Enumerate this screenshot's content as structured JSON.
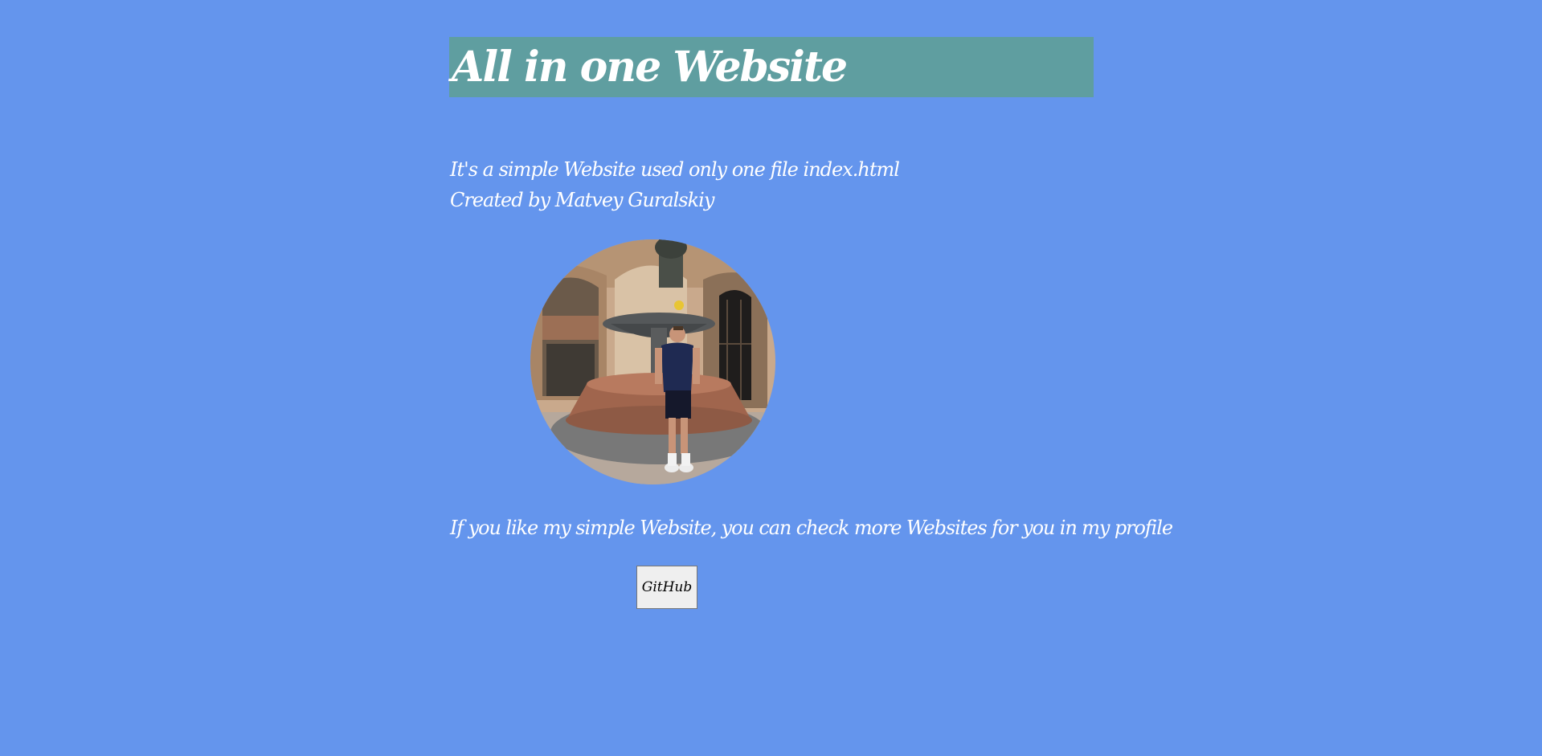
{
  "header": {
    "title": "All in one Website",
    "background_color": "#5f9ea0"
  },
  "intro": {
    "line1": "It's a simple Website used only one file index.html",
    "line2": "Created by Matvey Guralskiy"
  },
  "photo": {
    "alt": "Photo of a man standing in front of a stone fountain in an arched courtyard"
  },
  "cta": {
    "text": "If you like my simple Website, you can check more Websites for you in my profile"
  },
  "github_button": {
    "label": "GitHub"
  },
  "colors": {
    "page_background": "#6495ed",
    "text": "#ffffff",
    "button_background": "#efefef"
  }
}
